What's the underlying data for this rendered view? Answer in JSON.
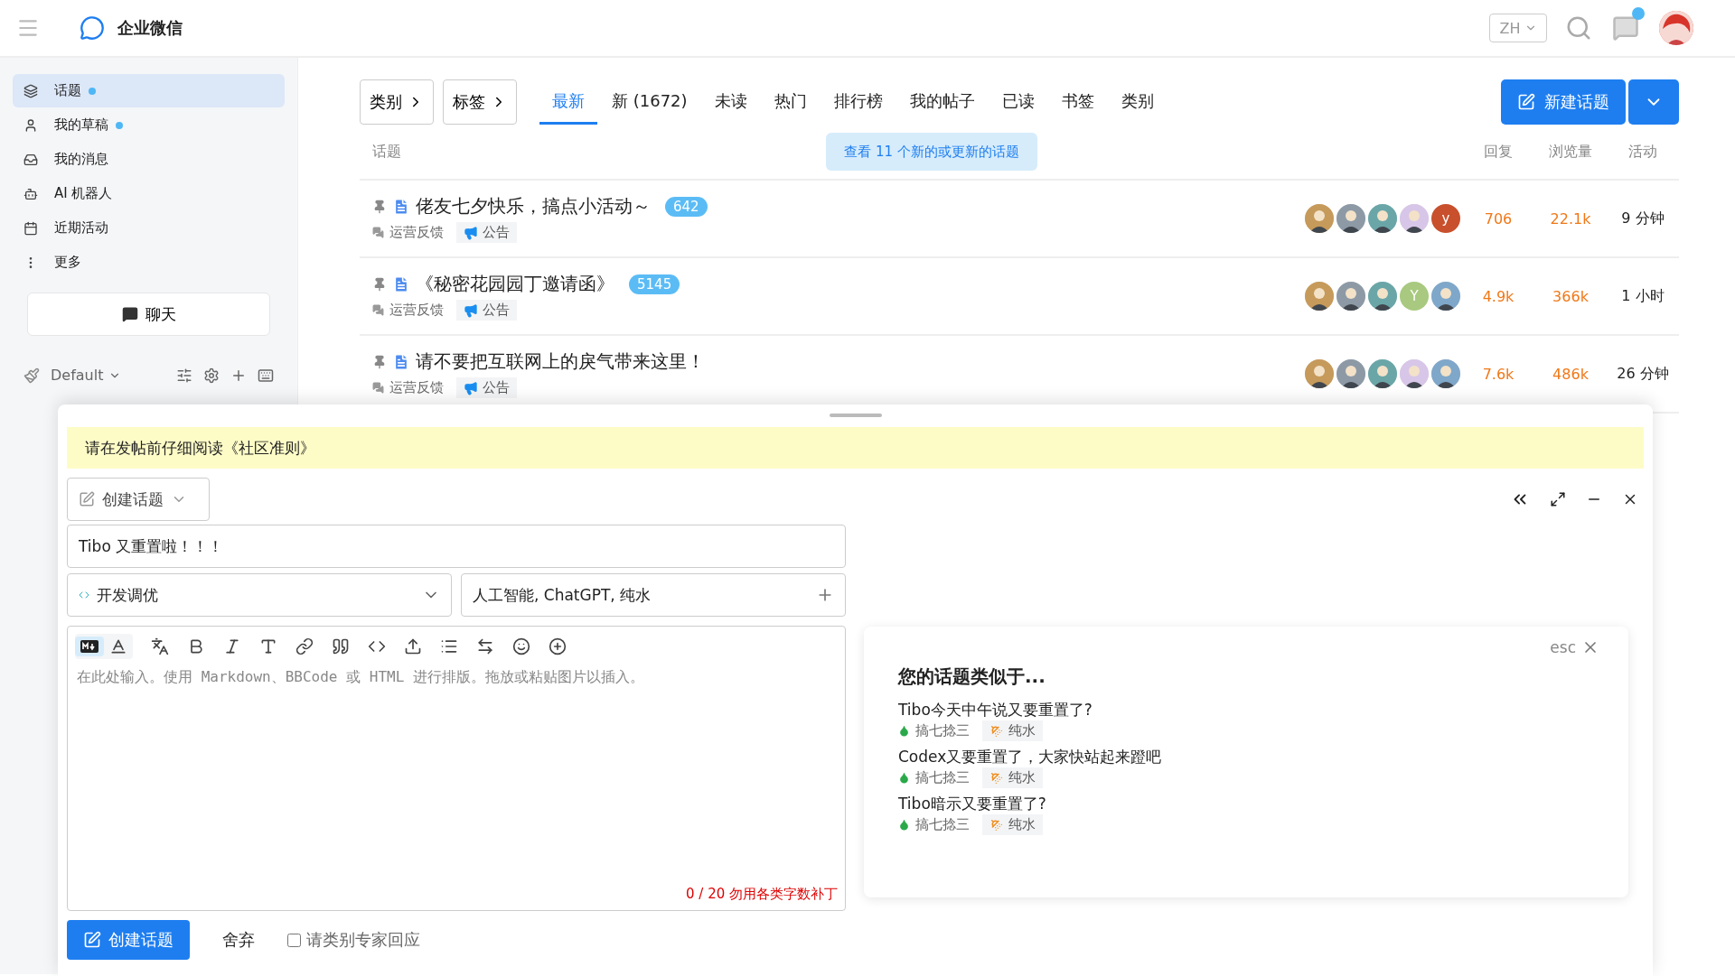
{
  "header": {
    "logo": "企业微信",
    "language": "ZH",
    "unread": true
  },
  "sidebar": {
    "items": [
      {
        "label": "话题",
        "dot": true,
        "selected": true
      },
      {
        "label": "我的草稿",
        "dot": true,
        "selected": false
      },
      {
        "label": "我的消息",
        "dot": false,
        "selected": false
      },
      {
        "label": "AI 机器人",
        "dot": false,
        "selected": false
      },
      {
        "label": "近期活动",
        "dot": false,
        "selected": false
      },
      {
        "label": "更多",
        "dot": false,
        "selected": false
      }
    ],
    "chat_button": "聊天",
    "theme": "Default"
  },
  "nav": {
    "filters": [
      "类别",
      "标签"
    ],
    "tabs": [
      {
        "label": "最新",
        "selected": true
      },
      {
        "label": "新 (1672)",
        "selected": false
      },
      {
        "label": "未读",
        "selected": false
      },
      {
        "label": "热门",
        "selected": false
      },
      {
        "label": "排行榜",
        "selected": false
      },
      {
        "label": "我的帖子",
        "selected": false
      },
      {
        "label": "已读",
        "selected": false
      },
      {
        "label": "书签",
        "selected": false
      },
      {
        "label": "类别",
        "selected": false
      }
    ],
    "new_topic": "新建话题"
  },
  "list": {
    "columns": {
      "topic": "话题",
      "replies": "回复",
      "views": "浏览量",
      "activity": "活动"
    },
    "new_notice": "查看 11 个新的或更新的话题",
    "rows": [
      {
        "title": "佬友七夕快乐，搞点小活动～",
        "count": "642",
        "category": "运营反馈",
        "tag": "公告",
        "posters": [
          {
            "kind": "picture"
          },
          {
            "kind": "picture"
          },
          {
            "kind": "picture"
          },
          {
            "kind": "picture"
          },
          {
            "kind": "letter",
            "letter": "y",
            "color": "#c8502c"
          }
        ],
        "replies": "706",
        "views": "22.1k",
        "activity": "9 分钟"
      },
      {
        "title": "《秘密花园园丁邀请函》",
        "count": "5145",
        "category": "运营反馈",
        "tag": "公告",
        "posters": [
          {
            "kind": "picture"
          },
          {
            "kind": "picture"
          },
          {
            "kind": "picture"
          },
          {
            "kind": "letter",
            "letter": "Y",
            "color": "#a8c97f"
          },
          {
            "kind": "picture"
          }
        ],
        "replies": "4.9k",
        "views": "366k",
        "activity": "1 小时"
      },
      {
        "title": "请不要把互联网上的戾气带来这里！",
        "category": "运营反馈",
        "tag": "公告",
        "posters": [
          {
            "kind": "picture"
          },
          {
            "kind": "picture"
          },
          {
            "kind": "picture"
          },
          {
            "kind": "picture"
          },
          {
            "kind": "picture"
          }
        ],
        "replies": "7.6k",
        "views": "486k",
        "activity": "26 分钟"
      }
    ]
  },
  "composer": {
    "notice": "请在发帖前仔细阅读《社区准则》",
    "action": "创建话题",
    "title_value": "Tibo 又重置啦！！！",
    "category": "开发调优",
    "tags_value": "人工智能, ChatGPT, 纯水",
    "editor": {
      "markdown": true,
      "placeholder": "在此处输入。使用 Markdown、BBCode 或 HTML 进行排版。拖放或粘贴图片以插入。",
      "counter": "0 / 20 勿用各类字数补丁"
    },
    "similar": {
      "esc": "esc",
      "heading": "您的话题类似于...",
      "items": [
        {
          "title": "Tibo今天中午说又要重置了?",
          "category": "搞七捻三",
          "tag": "纯水"
        },
        {
          "title": "Codex又要重置了，大家快站起来蹬吧",
          "category": "搞七捻三",
          "tag": "纯水"
        },
        {
          "title": "Tibo暗示又要重置了?",
          "category": "搞七捻三",
          "tag": "纯水"
        }
      ]
    },
    "footer": {
      "submit": "创建话题",
      "discard": "舍弃",
      "expert": {
        "label": "请类别专家回应",
        "checked": false
      }
    }
  }
}
